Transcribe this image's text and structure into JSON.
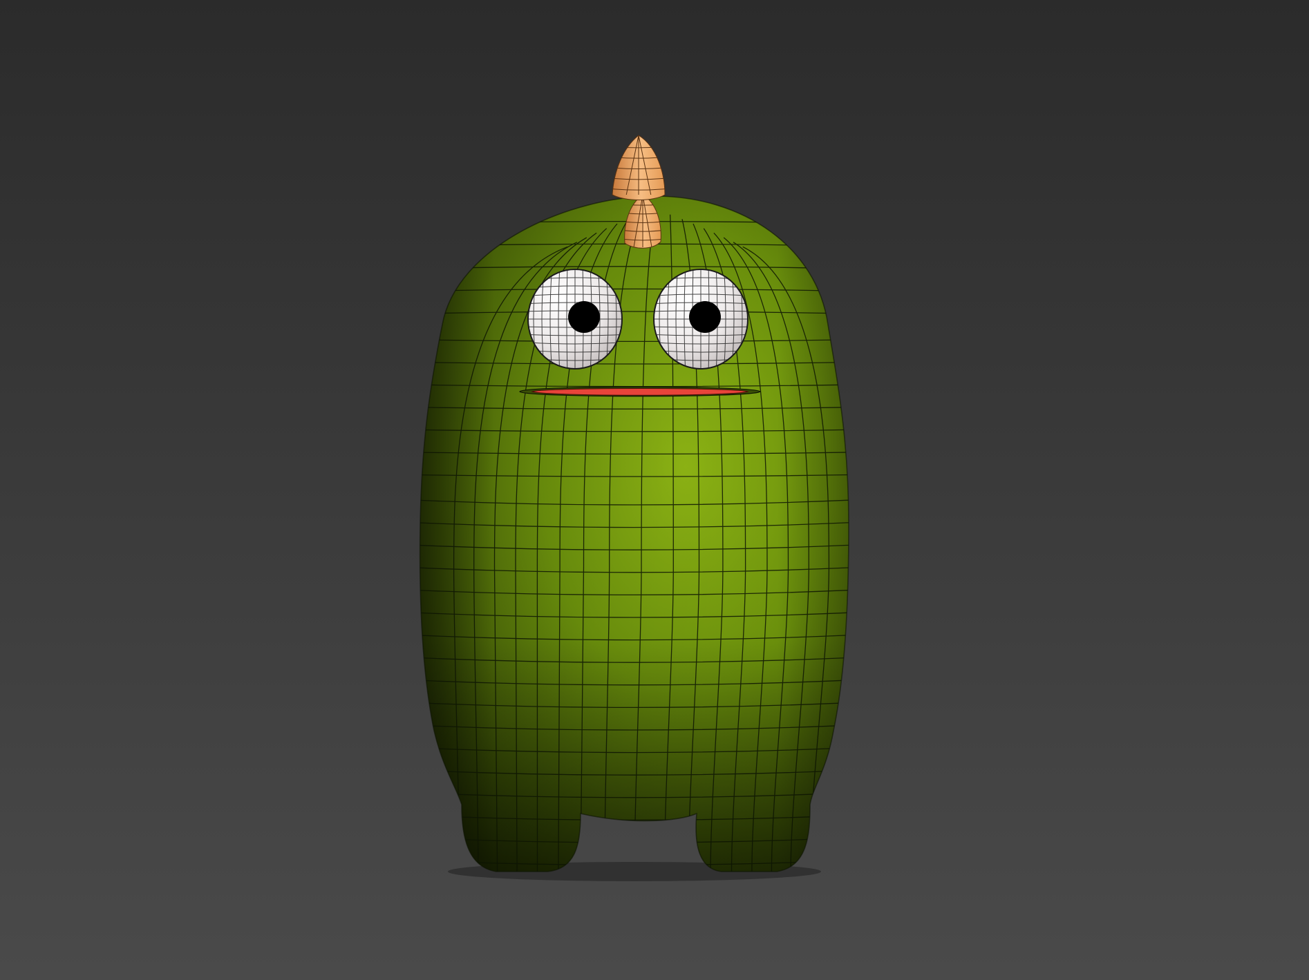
{
  "scene": {
    "subject": "green-monster-wireframe-model",
    "colors": {
      "background_top": "#2b2b2b",
      "background_bottom": "#4a4a4a",
      "body": "#6a8f0c",
      "body_light": "#8db414",
      "body_shadow": "#2c3d04",
      "wire": "#0d1404",
      "horn": "#e59a55",
      "horn_light": "#f6bd82",
      "eye_white": "#ece8e8",
      "pupil": "#000000",
      "mouth": "#e8443a"
    },
    "icons": [
      "horn-icon",
      "eye-icon",
      "pupil-icon",
      "mouth-icon"
    ]
  }
}
